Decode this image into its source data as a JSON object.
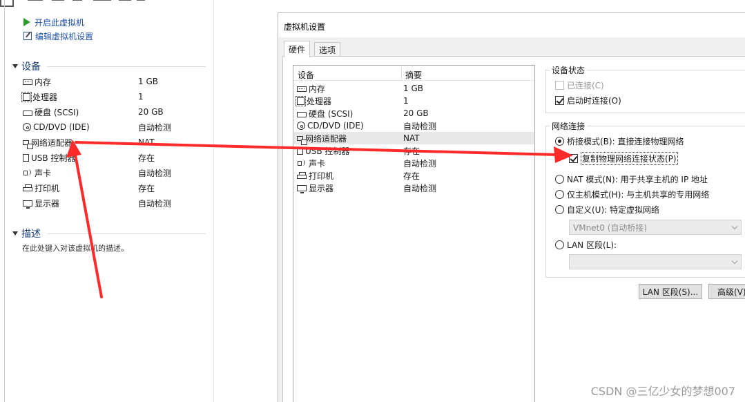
{
  "vm_panel": {
    "actions": {
      "power_on": "开启此虚拟机",
      "edit_settings": "编辑虚拟机设置"
    },
    "devices_section_title": "设备",
    "devices": [
      {
        "name": "内存",
        "value": "1 GB",
        "icon": "memory-icon"
      },
      {
        "name": "处理器",
        "value": "1",
        "icon": "cpu-icon"
      },
      {
        "name": "硬盘 (SCSI)",
        "value": "20 GB",
        "icon": "hard-disk-icon"
      },
      {
        "name": "CD/DVD (IDE)",
        "value": "自动检测",
        "icon": "cd-icon"
      },
      {
        "name": "网络适配器",
        "value": "NAT",
        "icon": "network-adapter-icon"
      },
      {
        "name": "USB 控制器",
        "value": "存在",
        "icon": "usb-icon"
      },
      {
        "name": "声卡",
        "value": "自动检测",
        "icon": "sound-icon"
      },
      {
        "name": "打印机",
        "value": "存在",
        "icon": "printer-icon"
      },
      {
        "name": "显示器",
        "value": "自动检测",
        "icon": "display-icon"
      }
    ],
    "description_section_title": "描述",
    "description_placeholder": "在此处键入对该虚拟机的描述。"
  },
  "dialog": {
    "title": "虚拟机设置",
    "tabs": [
      "硬件",
      "选项"
    ],
    "device_list": {
      "columns": [
        "设备",
        "摘要"
      ],
      "rows": [
        {
          "name": "内存",
          "summary": "1 GB",
          "icon": "memory-icon"
        },
        {
          "name": "处理器",
          "summary": "1",
          "icon": "cpu-icon"
        },
        {
          "name": "硬盘 (SCSI)",
          "summary": "20 GB",
          "icon": "hard-disk-icon"
        },
        {
          "name": "CD/DVD (IDE)",
          "summary": "自动检测",
          "icon": "cd-icon"
        },
        {
          "name": "网络适配器",
          "summary": "NAT",
          "icon": "network-adapter-icon",
          "selected": true
        },
        {
          "name": "USB 控制器",
          "summary": "存在",
          "icon": "usb-icon"
        },
        {
          "name": "声卡",
          "summary": "自动检测",
          "icon": "sound-icon"
        },
        {
          "name": "打印机",
          "summary": "存在",
          "icon": "printer-icon"
        },
        {
          "name": "显示器",
          "summary": "自动检测",
          "icon": "display-icon"
        }
      ]
    },
    "device_status": {
      "title": "设备状态",
      "connected": {
        "label": "已连接(C)",
        "checked": false,
        "enabled": false
      },
      "connect_on_power_on": {
        "label": "启动时连接(O)",
        "checked": true,
        "enabled": true
      }
    },
    "network_connection": {
      "title": "网络连接",
      "bridged": {
        "label": "桥接模式(B): 直接连接物理网络",
        "selected": true
      },
      "replicate_state": {
        "label": "复制物理网络连接状态(P)",
        "checked": true
      },
      "nat": {
        "label": "NAT 模式(N): 用于共享主机的 IP 地址",
        "selected": false
      },
      "host_only": {
        "label": "仅主机模式(H): 与主机共享的专用网络",
        "selected": false
      },
      "custom": {
        "label": "自定义(U): 特定虚拟网络",
        "selected": false
      },
      "custom_select_value": "VMnet0 (自动桥接)",
      "lan_segment": {
        "label": "LAN 区段(L):",
        "selected": false
      },
      "lan_segment_select_value": ""
    },
    "buttons": {
      "lan_segments": "LAN 区段(S)...",
      "advanced": "高级(V)..."
    }
  },
  "annotation": {
    "arrow_color": "#ff2a2a"
  },
  "watermark": "CSDN @三亿少女的梦想007"
}
